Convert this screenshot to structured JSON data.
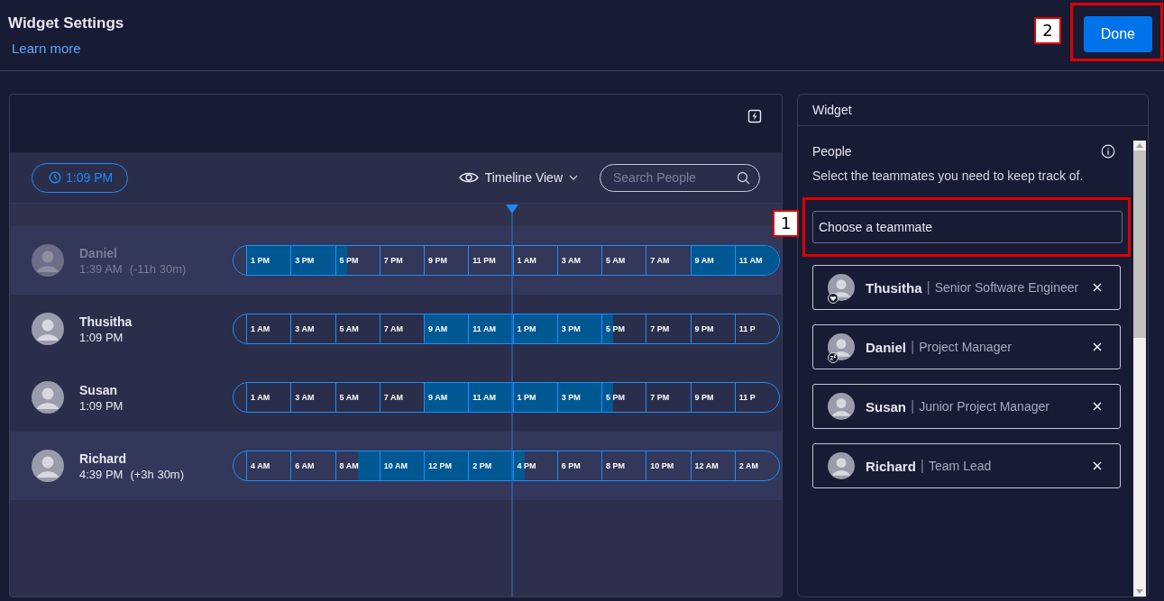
{
  "header": {
    "title": "Widget Settings",
    "link": "Learn more",
    "callout": "2",
    "done_button": "Done"
  },
  "timeline": {
    "current_time": "1:09 PM",
    "view_label": "Timeline View",
    "search": {
      "placeholder": "Search People"
    },
    "rows": [
      {
        "name": "Daniel",
        "time": "1:39 AM",
        "offset": "(-11h 30m)",
        "dimmed": true,
        "highlight": true,
        "segments": [
          {
            "label": "1 PM",
            "kind": "shaded"
          },
          {
            "label": "3 PM",
            "kind": "shaded"
          },
          {
            "label": "5 PM",
            "kind": "shadedleft"
          },
          {
            "label": "7 PM",
            "kind": "plain"
          },
          {
            "label": "9 PM",
            "kind": "plain"
          },
          {
            "label": "11 PM",
            "kind": "plain"
          },
          {
            "label": "1 AM",
            "kind": "plain"
          },
          {
            "label": "3 AM",
            "kind": "plain"
          },
          {
            "label": "5 AM",
            "kind": "plain"
          },
          {
            "label": "7 AM",
            "kind": "plain"
          },
          {
            "label": "9 AM",
            "kind": "shaded"
          },
          {
            "label": "11 AM",
            "kind": "shaded"
          }
        ]
      },
      {
        "name": "Thusitha",
        "time": "1:09 PM",
        "dimmed": false,
        "highlight": false,
        "segments": [
          {
            "label": "1 AM",
            "kind": "plain"
          },
          {
            "label": "3 AM",
            "kind": "plain"
          },
          {
            "label": "5 AM",
            "kind": "plain"
          },
          {
            "label": "7 AM",
            "kind": "plain"
          },
          {
            "label": "9 AM",
            "kind": "shaded"
          },
          {
            "label": "11 AM",
            "kind": "shaded"
          },
          {
            "label": "1 PM",
            "kind": "shaded"
          },
          {
            "label": "3 PM",
            "kind": "shaded"
          },
          {
            "label": "5 PM",
            "kind": "shadedleft"
          },
          {
            "label": "7 PM",
            "kind": "plain"
          },
          {
            "label": "9 PM",
            "kind": "plain"
          },
          {
            "label": "11 P",
            "kind": "plain"
          }
        ]
      },
      {
        "name": "Susan",
        "time": "1:09 PM",
        "dimmed": false,
        "highlight": false,
        "segments": [
          {
            "label": "1 AM",
            "kind": "plain"
          },
          {
            "label": "3 AM",
            "kind": "plain"
          },
          {
            "label": "5 AM",
            "kind": "plain"
          },
          {
            "label": "7 AM",
            "kind": "plain"
          },
          {
            "label": "9 AM",
            "kind": "shaded"
          },
          {
            "label": "11 AM",
            "kind": "shaded"
          },
          {
            "label": "1 PM",
            "kind": "shaded"
          },
          {
            "label": "3 PM",
            "kind": "shaded"
          },
          {
            "label": "5 PM",
            "kind": "shadedleft"
          },
          {
            "label": "7 PM",
            "kind": "plain"
          },
          {
            "label": "9 PM",
            "kind": "plain"
          },
          {
            "label": "11 P",
            "kind": "plain"
          }
        ]
      },
      {
        "name": "Richard",
        "time": "4:39 PM",
        "offset": "(+3h 30m)",
        "dimmed": false,
        "highlight": true,
        "segments": [
          {
            "label": "4 AM",
            "kind": "plain"
          },
          {
            "label": "6 AM",
            "kind": "plain"
          },
          {
            "label": "8 AM",
            "kind": "shadedright"
          },
          {
            "label": "10 AM",
            "kind": "shaded"
          },
          {
            "label": "12 PM",
            "kind": "shaded"
          },
          {
            "label": "2 PM",
            "kind": "shaded"
          },
          {
            "label": "4 PM",
            "kind": "shadedleft"
          },
          {
            "label": "6 PM",
            "kind": "plain"
          },
          {
            "label": "8 PM",
            "kind": "plain"
          },
          {
            "label": "10 PM",
            "kind": "plain"
          },
          {
            "label": "12 AM",
            "kind": "plain"
          },
          {
            "label": "2 AM",
            "kind": "plain"
          }
        ]
      }
    ]
  },
  "widget": {
    "title": "Widget",
    "section": "People",
    "description": "Select the teammates you need to keep track of.",
    "callout": "1",
    "field": {
      "placeholder": "Choose a teammate"
    },
    "people": [
      {
        "name": "Thusitha",
        "separator": "|",
        "role": "Senior Software Engineer",
        "kind": "heart"
      },
      {
        "name": "Daniel",
        "separator": "|",
        "role": "Project Manager",
        "kind": "sleep"
      },
      {
        "name": "Susan",
        "separator": "|",
        "role": "Junior Project Manager",
        "kind": "plain"
      },
      {
        "name": "Richard",
        "separator": "|",
        "role": "Team Lead",
        "kind": "plain"
      }
    ]
  }
}
